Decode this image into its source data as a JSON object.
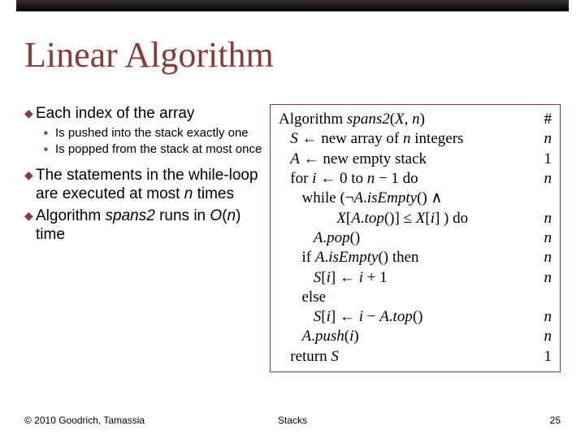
{
  "title": "Linear Algorithm",
  "bullets": {
    "b1": "Each index of the array",
    "b1s1": "Is pushed into the stack exactly one",
    "b1s2": "Is popped from the stack at most once",
    "b2_pre": "The statements in the while-loop are executed at most ",
    "b2_n": "n",
    "b2_post": " times",
    "b3_pre": "Algorithm ",
    "b3_name": "spans2",
    "b3_mid": " runs in ",
    "b3_o": "O",
    "b3_paren_open": "(",
    "b3_n": "n",
    "b3_paren_close": ")",
    "b3_post": " time"
  },
  "algo": {
    "l0c": "Algorithm ",
    "l0name": "spans2",
    "l0args_open": "(",
    "l0x": "X",
    "l0comma": ", ",
    "l0n": "n",
    "l0args_close": ")",
    "l0r": "#",
    "l1c_pre": "   ",
    "l1S": "S",
    "l1c_mid": " ← new array of ",
    "l1n": "n",
    "l1c_post": " integers",
    "l1r": "n",
    "l2c_pre": "   ",
    "l2A": "A",
    "l2c_post": " ← new empty stack",
    "l2r": "1",
    "l3c_pre": "   for ",
    "l3i": "i",
    "l3c_mid": " ← 0 to ",
    "l3n": "n",
    "l3c_post": " − 1 do",
    "l3r": "n",
    "l4c_pre": "      while (¬",
    "l4A": "A",
    "l4c_mid": ".",
    "l4isE": "isEmpty",
    "l4c_post": "() ∧",
    "l5c_pre": "               ",
    "l5X": "X",
    "l5c_b1": "[",
    "l5A": "A",
    "l5top": "top",
    "l5c_b2": "()] ≤ ",
    "l5X2": "X",
    "l5c_b3": "[",
    "l5i": "i",
    "l5c_b4": "] ) do",
    "l5r": "n",
    "l6c_pre": "         ",
    "l6A": "A",
    "l6pop": "pop",
    "l6c_post": "()",
    "l6r": "n",
    "l7c_pre": "      if ",
    "l7A": "A",
    "l7isE": "isEmpty",
    "l7c_post": "() then",
    "l7r": "n",
    "l8c_pre": "         ",
    "l8S": "S",
    "l8c_b1": "[",
    "l8i": "i",
    "l8c_b2": "] ← ",
    "l8i2": "i",
    "l8c_post": " + 1",
    "l8r": "n",
    "l9c": "      else",
    "l10c_pre": "         ",
    "l10S": "S",
    "l10c_b1": "[",
    "l10i": "i",
    "l10c_b2": "] ← ",
    "l10i2": "i",
    "l10c_mid": " − ",
    "l10A": "A",
    "l10top": "top",
    "l10c_post": "()",
    "l10r": "n",
    "l11c_pre": "      ",
    "l11A": "A",
    "l11push": "push",
    "l11c_b1": "(",
    "l11i": "i",
    "l11c_b2": ")",
    "l11r": "n",
    "l12c_pre": "   return ",
    "l12S": "S",
    "l12r": "1"
  },
  "footer": {
    "left": "© 2010 Goodrich, Tamassia",
    "center": "Stacks",
    "right": "25"
  }
}
